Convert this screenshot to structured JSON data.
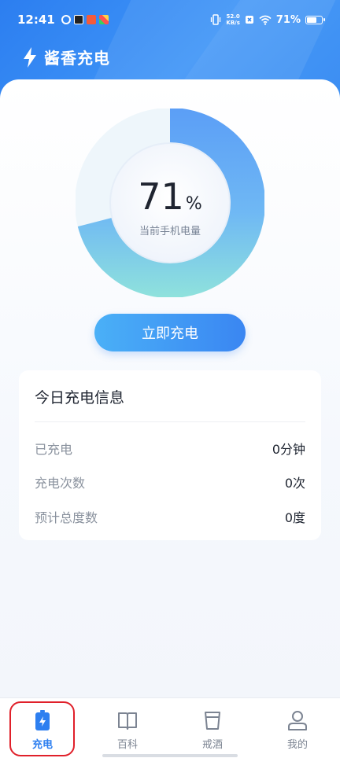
{
  "status_bar": {
    "time": "12:41",
    "net_speed_value": "52.0",
    "net_speed_unit": "KB/s",
    "battery_text": "71%",
    "battery_level": 0.71
  },
  "app": {
    "title": "酱香充电"
  },
  "gauge": {
    "percent_value": "71",
    "percent_sign": "%",
    "label": "当前手机电量",
    "level": 0.71,
    "colors": {
      "progress": "#4a92f4",
      "track": "#e8f3fb",
      "accent_ring": "#8fe2dc"
    }
  },
  "charge_button": {
    "label": "立即充电"
  },
  "info": {
    "title": "今日充电信息",
    "rows": [
      {
        "key": "已充电",
        "value": "0分钟"
      },
      {
        "key": "充电次数",
        "value": "0次"
      },
      {
        "key": "预计总度数",
        "value": "0度"
      }
    ]
  },
  "tabs": [
    {
      "label": "充电",
      "icon": "battery-charging-icon",
      "active": true
    },
    {
      "label": "百科",
      "icon": "book-icon",
      "active": false
    },
    {
      "label": "戒酒",
      "icon": "cup-icon",
      "active": false
    },
    {
      "label": "我的",
      "icon": "user-icon",
      "active": false
    }
  ],
  "colors": {
    "accent": "#2d7ff0",
    "highlight": "#e0202a"
  }
}
